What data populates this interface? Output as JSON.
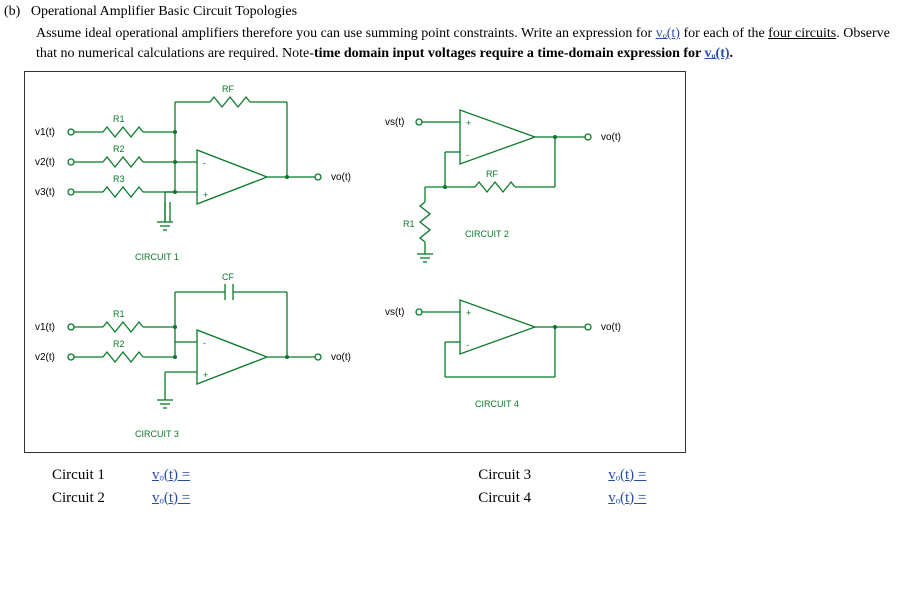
{
  "header": {
    "part": "(b)",
    "title": "Operational Amplifier Basic Circuit Topologies"
  },
  "paragraph": {
    "p1_a": "Assume ideal operational amplifiers therefore you can use summing point constraints.  Write an expression for ",
    "vo_t_link": "vₒ(t)",
    "p1_b": " for each of the ",
    "four_circuits": "four circuits",
    "p1_c": ".  Observe that no numerical calculations are required.  Note-",
    "bold_part": "time domain input voltages require a time-domain expression for ",
    "vo_t_link2": "vₒ(t)",
    "p1_end": "."
  },
  "circuits": {
    "c1": {
      "label": "CIRCUIT 1",
      "rf": "RF",
      "inputs": [
        {
          "src": "v1(t)",
          "r": "R1"
        },
        {
          "src": "v2(t)",
          "r": "R2"
        },
        {
          "src": "v3(t)",
          "r": "R3"
        }
      ],
      "out": "vo(t)"
    },
    "c2": {
      "label": "CIRCUIT 2",
      "src": "vs(t)",
      "rf": "RF",
      "r1": "R1",
      "out": "vo(t)"
    },
    "c3": {
      "label": "CIRCUIT 3",
      "cf": "CF",
      "inputs": [
        {
          "src": "v1(t)",
          "r": "R1"
        },
        {
          "src": "v2(t)",
          "r": "R2"
        }
      ],
      "out": "vo(t)"
    },
    "c4": {
      "label": "CIRCUIT 4",
      "src": "vs(t)",
      "out": "vo(t)"
    }
  },
  "answers": {
    "c1": {
      "name": "Circuit 1",
      "lhs": "vₒ(t) ="
    },
    "c2": {
      "name": "Circuit 2",
      "lhs": "vₒ(t) ="
    },
    "c3": {
      "name": "Circuit 3",
      "lhs": "vₒ(t)  ="
    },
    "c4": {
      "name": "Circuit 4",
      "lhs": "vₒ(t)  ="
    }
  }
}
